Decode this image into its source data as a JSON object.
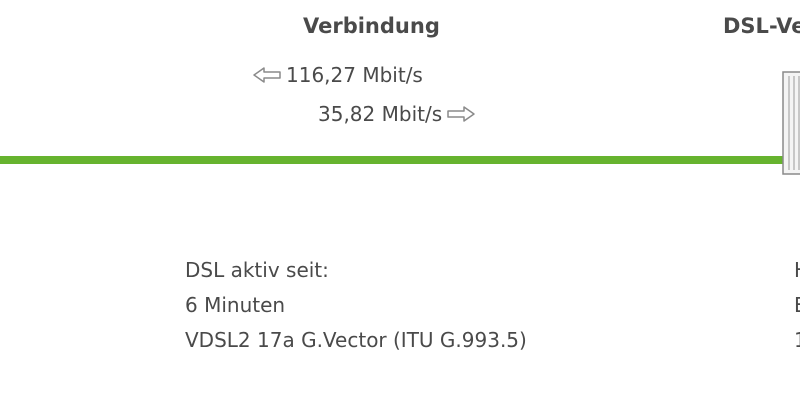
{
  "connection": {
    "title": "Verbindung",
    "downstream": "116,27 Mbit/s",
    "upstream": "35,82 Mbit/s",
    "line_color": "#66b32e"
  },
  "dsl_panel": {
    "title_partial": "DSL-Ve"
  },
  "status": {
    "label": "DSL aktiv seit:",
    "duration": "6 Minuten",
    "mode": "VDSL2 17a G.Vector (ITU G.993.5)"
  },
  "right_column": {
    "line1": "H",
    "line2": "E",
    "line3": "1"
  },
  "icons": {
    "downstream_arrow": "arrow-left-icon",
    "upstream_arrow": "arrow-right-icon",
    "device": "dsl-device-icon"
  }
}
